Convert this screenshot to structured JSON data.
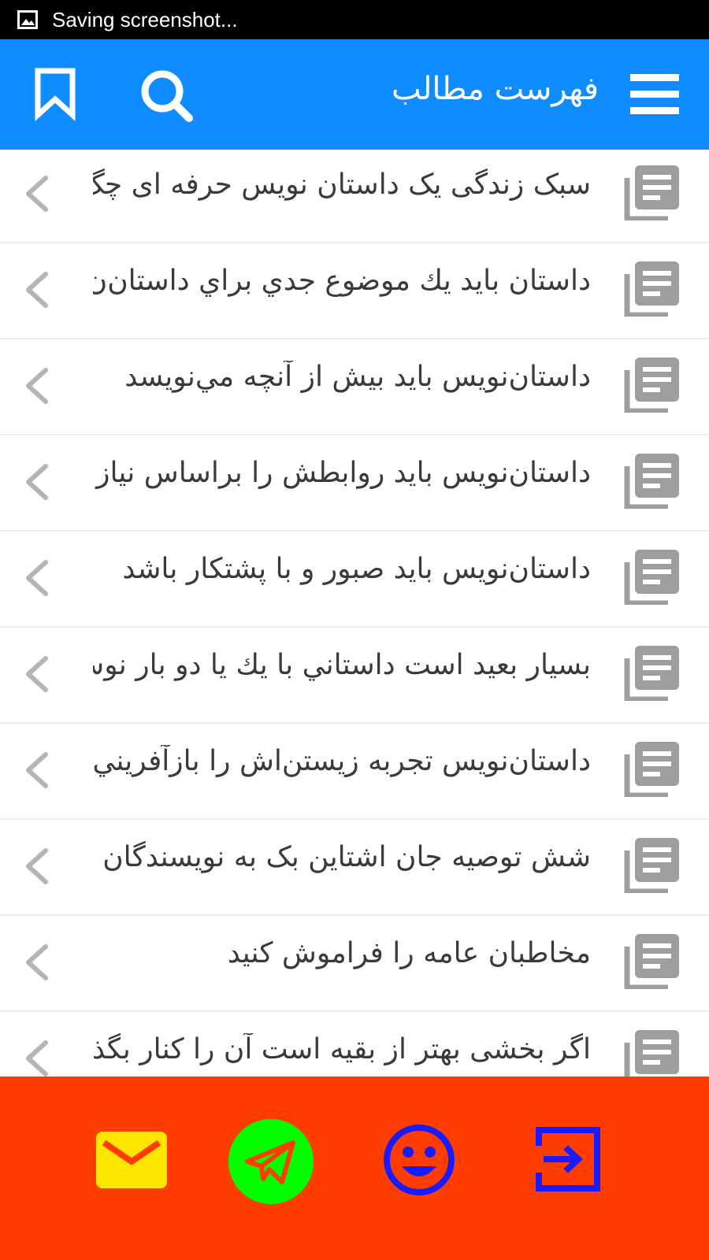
{
  "status_bar": {
    "text": "Saving screenshot..."
  },
  "header": {
    "title": "فهرست مطالب"
  },
  "articles": [
    {
      "title": "سبک زندگی یک داستان نویس حرفه ای چگ"
    },
    {
      "title": "داستان بايد يك موضوع جدي براي داستان‌ن"
    },
    {
      "title": "داستان‌نويس بايد بيش از آنچه مي‌نويسد"
    },
    {
      "title": "داستان‌نويس بايد روابطش را براساس نياز ک"
    },
    {
      "title": "داستان‌نويس بايد صبور و با پشتكار باشد"
    },
    {
      "title": "بسيار بعيد است داستاني با يك يا دو بار نوش"
    },
    {
      "title": "داستان‌نويس تجربه زيستن‌اش را بازآفريني"
    },
    {
      "title": "شش توصیه جان اشتاین بک به نویسندگان"
    },
    {
      "title": "مخاطبان عامه را فراموش کنید"
    },
    {
      "title": "اگر بخشی بهتر از بقیه است آن را کنار بگذار"
    }
  ],
  "icons": {
    "header": [
      "bookmark-icon",
      "search-icon",
      "menu-icon"
    ],
    "row": [
      "chevron-left-icon",
      "article-icon"
    ],
    "footer": [
      "mail-icon",
      "telegram-icon",
      "smiley-icon",
      "login-icon"
    ]
  },
  "colors": {
    "status_bar": "#000000",
    "app_bar": "#0f8cff",
    "footer": "#ff3d00",
    "mail": "#ffe600",
    "telegram": "#00ff00",
    "smiley": "#1a1aff",
    "login": "#1a1aff",
    "row_icon": "#9e9e9e",
    "row_text": "#3a3a3a"
  }
}
